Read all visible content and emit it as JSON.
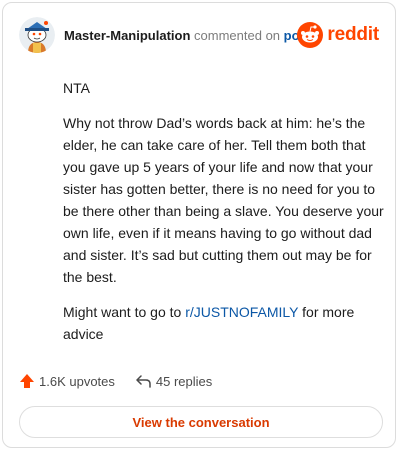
{
  "header": {
    "username": "Master-Manipulation",
    "action_text": "commented on",
    "post_link": "post",
    "brand": "reddit"
  },
  "comment": {
    "paragraphs": [
      "NTA",
      "Why not throw Dad’s words back at him: he’s the elder, he can take care of her. Tell them both that you gave up 5 years of your life and now that your sister has gotten better, there is no need for you to be there other than being a slave. You deserve your own life, even if it means having to go without dad and sister. It’s sad but cutting them out may be for the best."
    ],
    "last_pre": "Might want to go to ",
    "last_link": "r/JUSTNOFAMILY",
    "last_post": " for more advice"
  },
  "footer": {
    "upvotes": "1.6K upvotes",
    "replies": "45 replies",
    "cta": "View the conversation"
  },
  "colors": {
    "brand": "#ff4500",
    "link": "#0b57a6",
    "cta_text": "#d93a00"
  },
  "icons": {
    "avatar": "snoo-avatar-icon",
    "logo": "reddit-logo-icon",
    "upvote": "upvote-arrow-icon",
    "reply": "reply-arrow-icon"
  }
}
